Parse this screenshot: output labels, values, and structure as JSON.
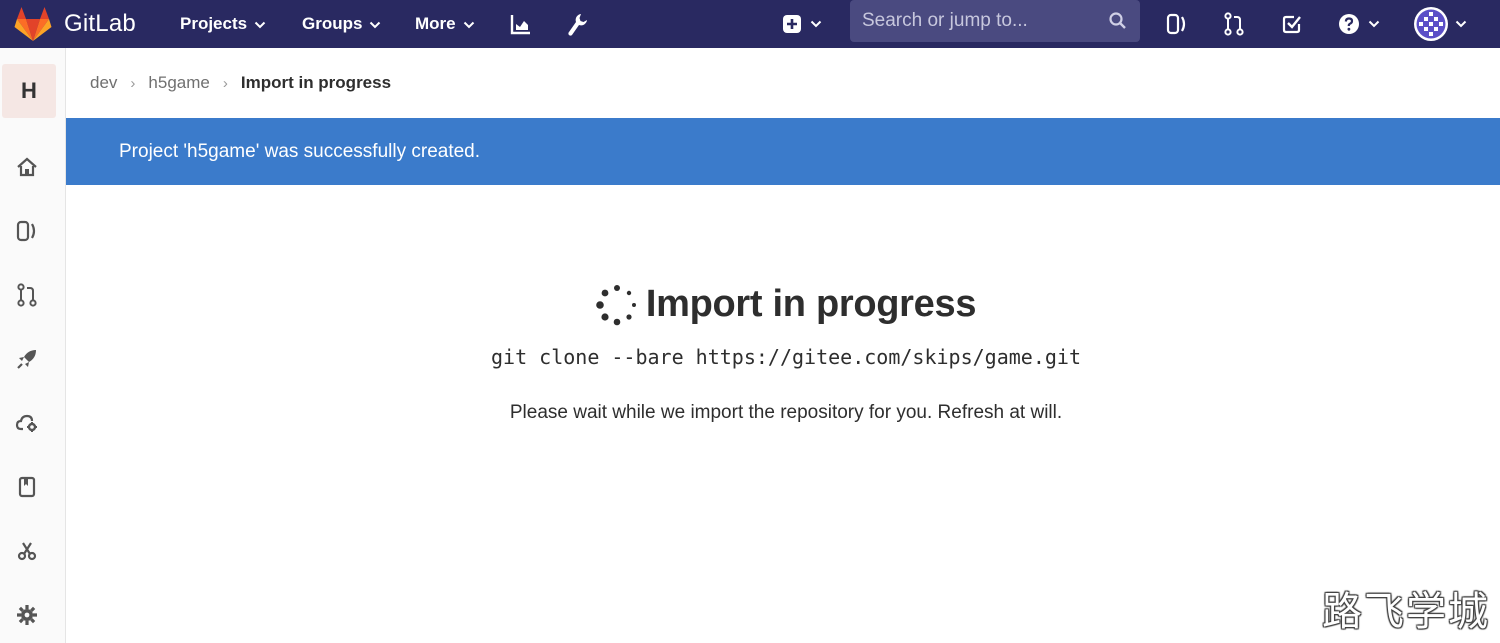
{
  "navbar": {
    "brand": "GitLab",
    "menus": [
      {
        "label": "Projects"
      },
      {
        "label": "Groups"
      },
      {
        "label": "More"
      }
    ],
    "search_placeholder": "Search or jump to..."
  },
  "sidebar": {
    "project_initial": "H"
  },
  "breadcrumb": {
    "items": [
      "dev",
      "h5game"
    ],
    "current": "Import in progress"
  },
  "flash": {
    "message": "Project 'h5game' was successfully created."
  },
  "main": {
    "title": "Import in progress",
    "clone_command": "git clone --bare https://gitee.com/skips/game.git",
    "wait_message": "Please wait while we import the repository for you. Refresh at will."
  },
  "watermark": "路飞学城",
  "colors": {
    "navbar": "#292961",
    "flash": "#3b7bcb",
    "search_bg": "#4a4a80",
    "project_avatar": "#f5e7e4"
  }
}
